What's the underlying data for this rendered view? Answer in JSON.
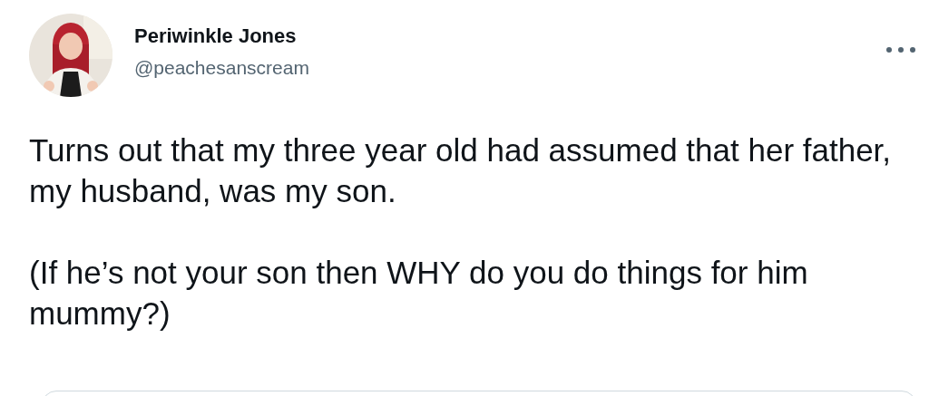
{
  "author": {
    "name": "Periwinkle Jones",
    "handle": "@peachesanscream"
  },
  "tweet": {
    "paragraphs": [
      "Turns out that my three year old had assumed that her father, my husband, was my son.",
      "(If he’s not your son then WHY do you do things for him mummy?)"
    ]
  }
}
